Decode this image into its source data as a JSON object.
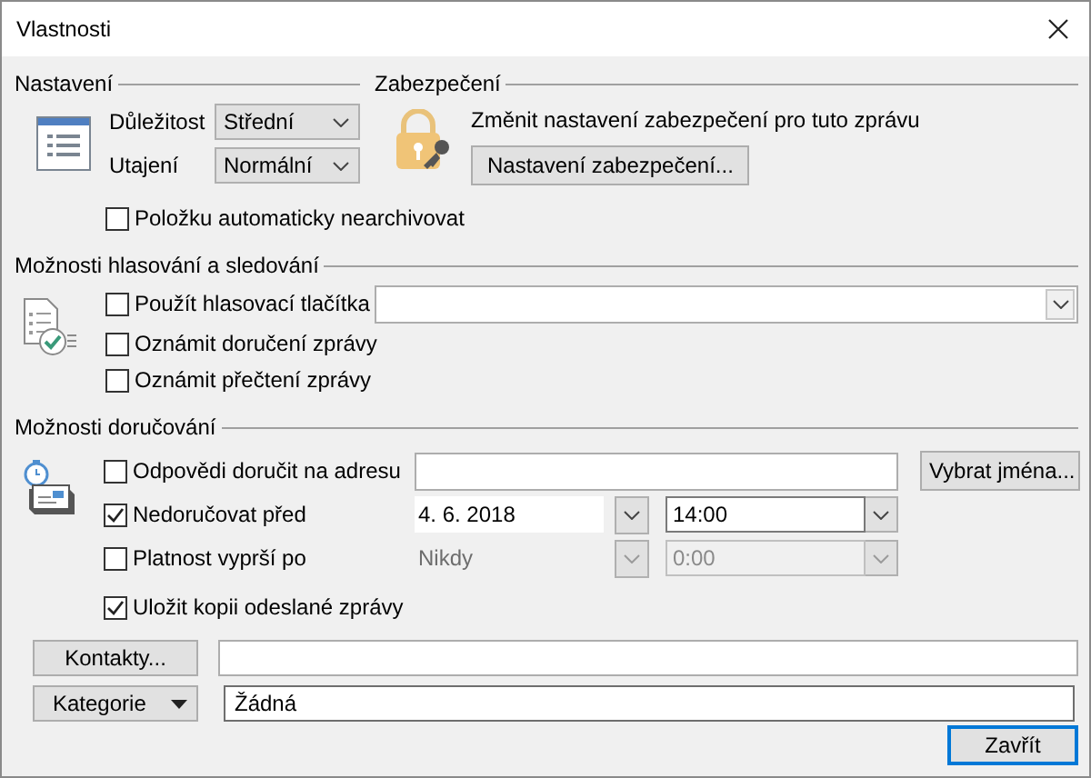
{
  "window": {
    "title": "Vlastnosti"
  },
  "settings": {
    "heading": "Nastavení",
    "fields": [
      {
        "label": "Důležitost",
        "value": "Střední"
      },
      {
        "label": "Utajení",
        "value": "Normální"
      }
    ],
    "options": [
      {
        "label": "Položku automaticky nearchivovat",
        "checked": false
      }
    ]
  },
  "security": {
    "heading": "Zabezpečení",
    "text": "Změnit nastavení zabezpečení pro tuto zprávu",
    "button": "Nastavení zabezpečení..."
  },
  "voting": {
    "heading": "Možnosti hlasování a sledování",
    "options": [
      {
        "kind": "combo",
        "label": "Použít hlasovací tlačítka",
        "checked": false
      },
      {
        "kind": "check",
        "label": "Oznámit doručení zprávy",
        "checked": false
      },
      {
        "kind": "check",
        "label": "Oznámit přečtení zprávy",
        "checked": false
      }
    ]
  },
  "delivery": {
    "heading": "Možnosti doručování",
    "rows": [
      {
        "kind": "address",
        "label": "Odpovědi doručit na adresu",
        "checked": false,
        "button": "Vybrat jména..."
      },
      {
        "kind": "datetime",
        "label": "Nedoručovat před",
        "checked": true,
        "disabled": false,
        "date": "4. 6. 2018",
        "time": "14:00"
      },
      {
        "kind": "datetime",
        "label": "Platnost vyprší po",
        "checked": false,
        "disabled": true,
        "date": "Nikdy",
        "time": "0:00"
      },
      {
        "kind": "check",
        "label": "Uložit kopii odeslané zprávy",
        "checked": true
      }
    ]
  },
  "contacts": {
    "button": "Kontakty..."
  },
  "categories": {
    "button": "Kategorie",
    "value": "Žádná"
  },
  "buttons": [
    {
      "label": "Zavřít",
      "default": true
    }
  ]
}
